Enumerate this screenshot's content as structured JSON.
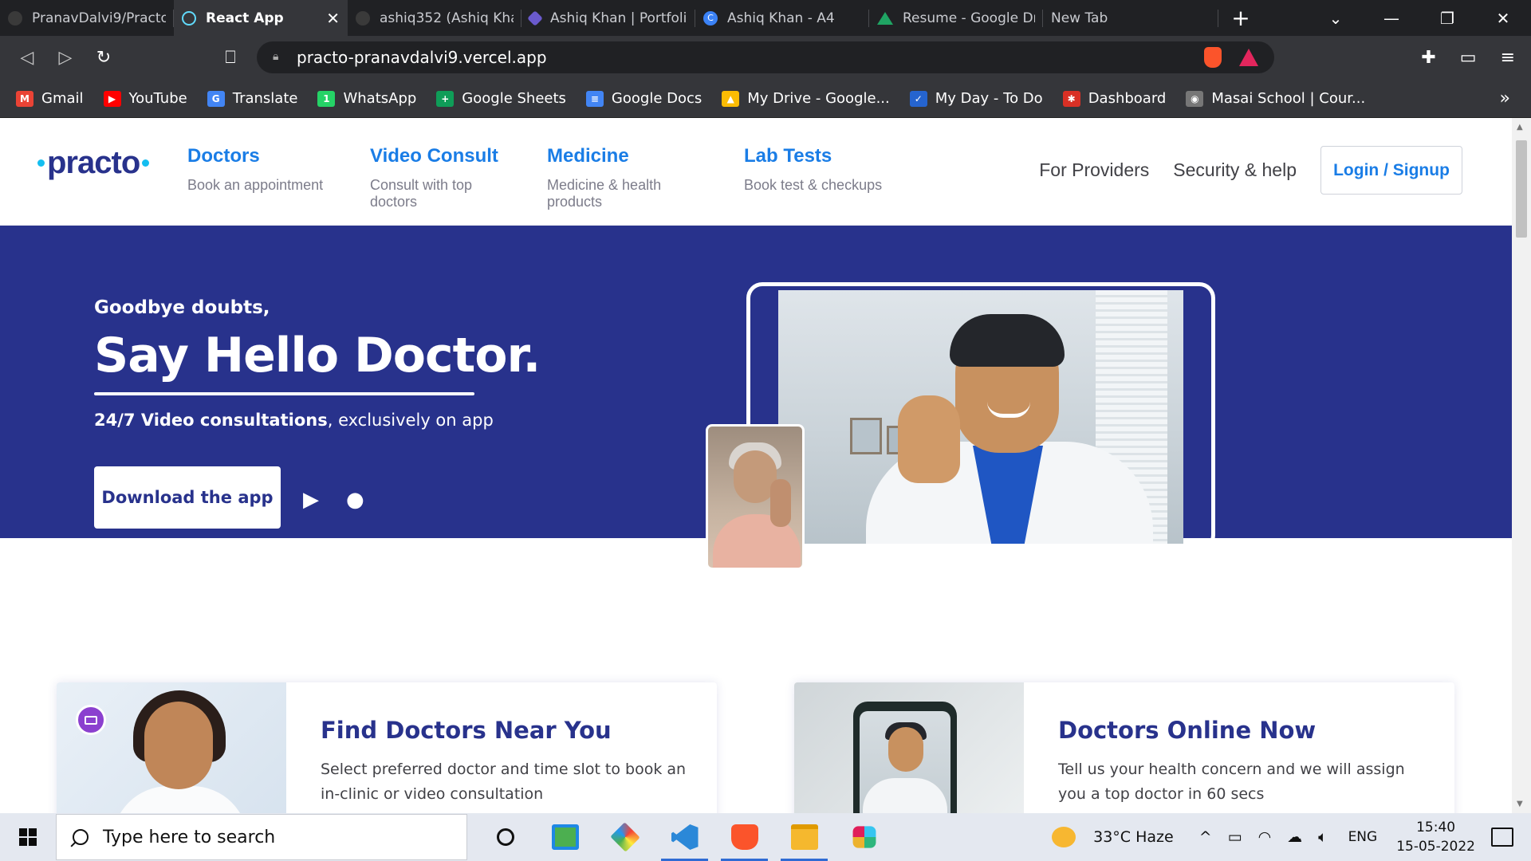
{
  "browser": {
    "tabs": [
      {
        "title": "PranavDalvi9/Practo",
        "fav_color": "#3a3a3a",
        "active": false
      },
      {
        "title": "React App",
        "fav_color": "#3a3a3a",
        "active": true
      },
      {
        "title": "ashiq352 (Ashiq Kha",
        "fav_color": "#3a3a3a",
        "active": false
      },
      {
        "title": "Ashiq Khan | Portfoli",
        "fav_color": "#6a5acd",
        "active": false
      },
      {
        "title": "Ashiq Khan - A4",
        "fav_color": "#3b82f6",
        "active": false
      },
      {
        "title": "Resume - Google Dr",
        "fav_color": "#1fa463",
        "active": false
      },
      {
        "title": "New Tab",
        "fav_color": "",
        "active": false
      }
    ],
    "url": "practo-pranavdalvi9.vercel.app",
    "bookmarks": [
      {
        "label": "Gmail",
        "color": "#ea4335",
        "glyph": "M"
      },
      {
        "label": "YouTube",
        "color": "#ff0000",
        "glyph": "▶"
      },
      {
        "label": "Translate",
        "color": "#4285f4",
        "glyph": "G"
      },
      {
        "label": "WhatsApp",
        "color": "#25d366",
        "glyph": "1"
      },
      {
        "label": "Google Sheets",
        "color": "#0f9d58",
        "glyph": "+"
      },
      {
        "label": "Google Docs",
        "color": "#4285f4",
        "glyph": "≡"
      },
      {
        "label": "My Drive - Google...",
        "color": "#fbbc04",
        "glyph": "▲"
      },
      {
        "label": "My Day - To Do",
        "color": "#2564cf",
        "glyph": "✓"
      },
      {
        "label": "Dashboard",
        "color": "#d93025",
        "glyph": "✱"
      },
      {
        "label": "Masai School | Cour...",
        "color": "#777777",
        "glyph": "◉"
      }
    ]
  },
  "practo": {
    "logo": "practo",
    "nav": [
      {
        "title": "Doctors",
        "subtitle": "Book an appointment"
      },
      {
        "title": "Video Consult",
        "subtitle": "Consult with top doctors"
      },
      {
        "title": "Medicine",
        "subtitle": "Medicine & health products"
      },
      {
        "title": "Lab Tests",
        "subtitle": "Book test & checkups"
      }
    ],
    "for_providers": "For Providers",
    "security_help": "Security & help",
    "login": "Login / Signup",
    "hero": {
      "kicker": "Goodbye doubts,",
      "headline": "Say Hello Doctor.",
      "sub_bold": "24/7 Video consultations",
      "sub_rest": ", exclusively on app",
      "download": "Download the app"
    },
    "cards": [
      {
        "title": "Find Doctors Near You",
        "desc": "Select preferred doctor and time slot to book an in-clinic or video consultation"
      },
      {
        "title": "Doctors Online Now",
        "desc": "Tell us your health concern and we will assign you a top doctor in 60 secs"
      }
    ]
  },
  "taskbar": {
    "search_placeholder": "Type here to search",
    "weather": "33°C  Haze",
    "lang": "ENG",
    "time": "15:40",
    "date": "15-05-2022"
  }
}
